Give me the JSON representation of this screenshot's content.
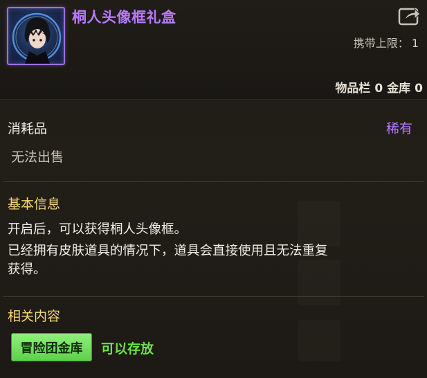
{
  "item": {
    "name": "桐人头像框礼盒",
    "icon": "kirito-avatar-frame-icon",
    "carry_limit_label": "携带上限：",
    "carry_limit_value": "1",
    "inventory_label": "物品栏",
    "inventory_count": "0",
    "vault_label": "金库",
    "vault_count": "0"
  },
  "category": {
    "type": "消耗品",
    "rarity": "稀有",
    "sell_status": "无法出售"
  },
  "basic_info": {
    "title": "基本信息",
    "lines": [
      "开启后，可以获得桐人头像框。",
      "已经拥有皮肤道具的情况下，道具会直接使用且无法重复",
      "获得。"
    ]
  },
  "related": {
    "title": "相关内容",
    "tag_label": "冒险团金库",
    "tag_note": "可以存放"
  },
  "colors": {
    "item_name": "#b77bff",
    "section_title": "#f5d77a",
    "tag_bg": "#6fe04a",
    "tag_note": "#6fe04a"
  }
}
